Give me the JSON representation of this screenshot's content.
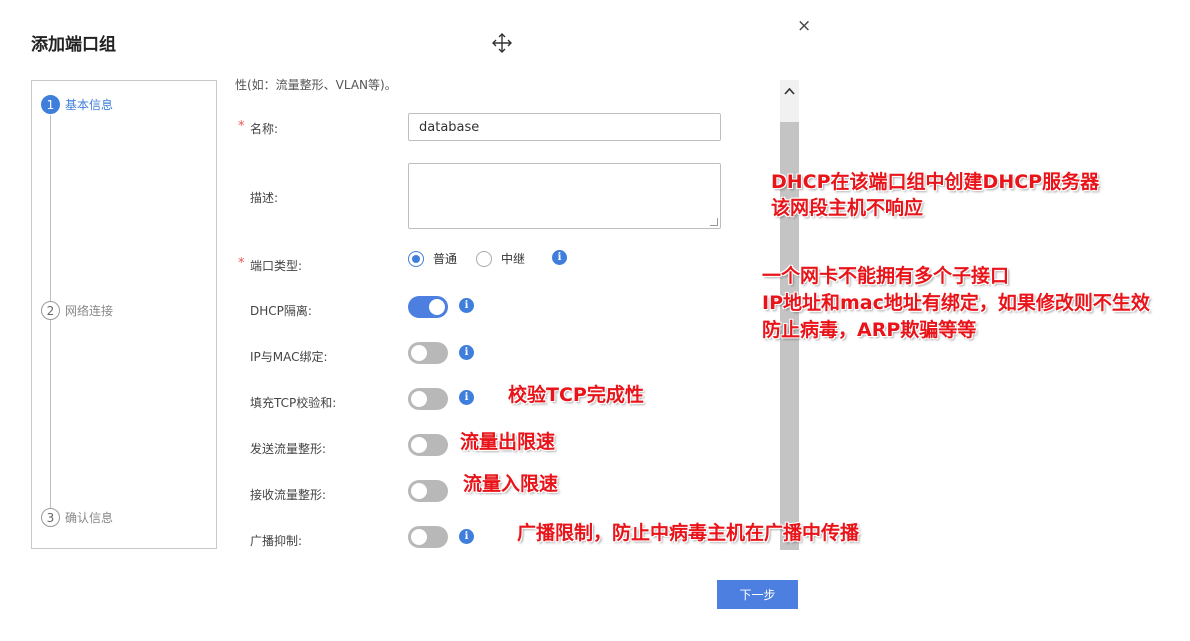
{
  "dialog": {
    "title": "添加端口组",
    "close": "×"
  },
  "steps": [
    {
      "num": "1",
      "label": "基本信息"
    },
    {
      "num": "2",
      "label": "网络连接"
    },
    {
      "num": "3",
      "label": "确认信息"
    }
  ],
  "form": {
    "truncated_text": "性(如：流量整形、VLAN等)。",
    "required_mark": "*",
    "name_label": "名称:",
    "name_value": "database",
    "desc_label": "描述:",
    "desc_value": "",
    "port_type_label": "端口类型:",
    "port_type_options": [
      "普通",
      "中继"
    ],
    "port_type_selected": "普通",
    "toggles": [
      {
        "label": "DHCP隔离:",
        "on": true
      },
      {
        "label": "IP与MAC绑定:",
        "on": false
      },
      {
        "label": "填充TCP校验和:",
        "on": false
      },
      {
        "label": "发送流量整形:",
        "on": false
      },
      {
        "label": "接收流量整形:",
        "on": false
      },
      {
        "label": "广播抑制:",
        "on": false
      }
    ],
    "info_icon": "i",
    "scroll_up": "^"
  },
  "next_button": "下一步",
  "annotations": {
    "dhcp_1": "DHCP在该端口组中创建DHCP服务器",
    "dhcp_2": "该网段主机不响应",
    "ipmac_1": "一个网卡不能拥有多个子接口",
    "ipmac_2": "IP地址和mac地址有绑定，如果修改则不生效",
    "ipmac_3": "防止病毒，ARP欺骗等等",
    "tcp": "校验TCP完成性",
    "send": "流量出限速",
    "recv": "流量入限速",
    "broadcast": "广播限制，防止中病毒主机在广播中传播"
  },
  "colors": {
    "accent": "#3f7fdb",
    "toggle_on": "#4c7fe0",
    "annotation": "#e8141a"
  },
  "icons": {
    "move": "move-arrows-icon",
    "info": "info-icon",
    "scroll_up": "chevron-up-icon"
  }
}
